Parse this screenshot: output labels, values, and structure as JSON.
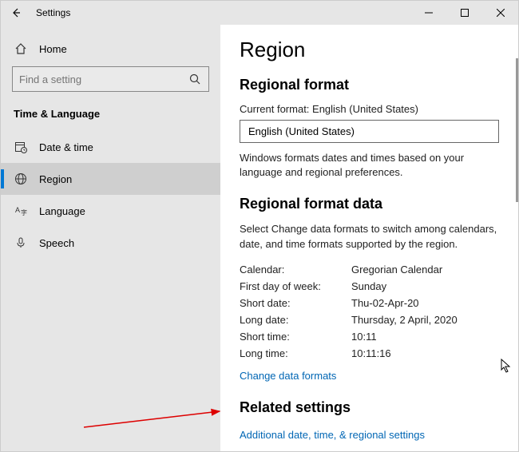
{
  "titlebar": {
    "title": "Settings"
  },
  "sidebar": {
    "home": "Home",
    "search_placeholder": "Find a setting",
    "category": "Time & Language",
    "items": [
      {
        "label": "Date & time"
      },
      {
        "label": "Region"
      },
      {
        "label": "Language"
      },
      {
        "label": "Speech"
      }
    ]
  },
  "main": {
    "title": "Region",
    "regional_format": {
      "heading": "Regional format",
      "current_label": "Current format: English (United States)",
      "dropdown_value": "English (United States)",
      "description": "Windows formats dates and times based on your language and regional preferences."
    },
    "format_data": {
      "heading": "Regional format data",
      "description": "Select Change data formats to switch among calendars, date, and time formats supported by the region.",
      "rows": [
        {
          "label": "Calendar:",
          "value": "Gregorian Calendar"
        },
        {
          "label": "First day of week:",
          "value": "Sunday"
        },
        {
          "label": "Short date:",
          "value": "Thu-02-Apr-20"
        },
        {
          "label": "Long date:",
          "value": "Thursday, 2 April, 2020"
        },
        {
          "label": "Short time:",
          "value": "10:11"
        },
        {
          "label": "Long time:",
          "value": "10:11:16"
        }
      ],
      "change_link": "Change data formats"
    },
    "related": {
      "heading": "Related settings",
      "link": "Additional date, time, & regional settings"
    }
  }
}
